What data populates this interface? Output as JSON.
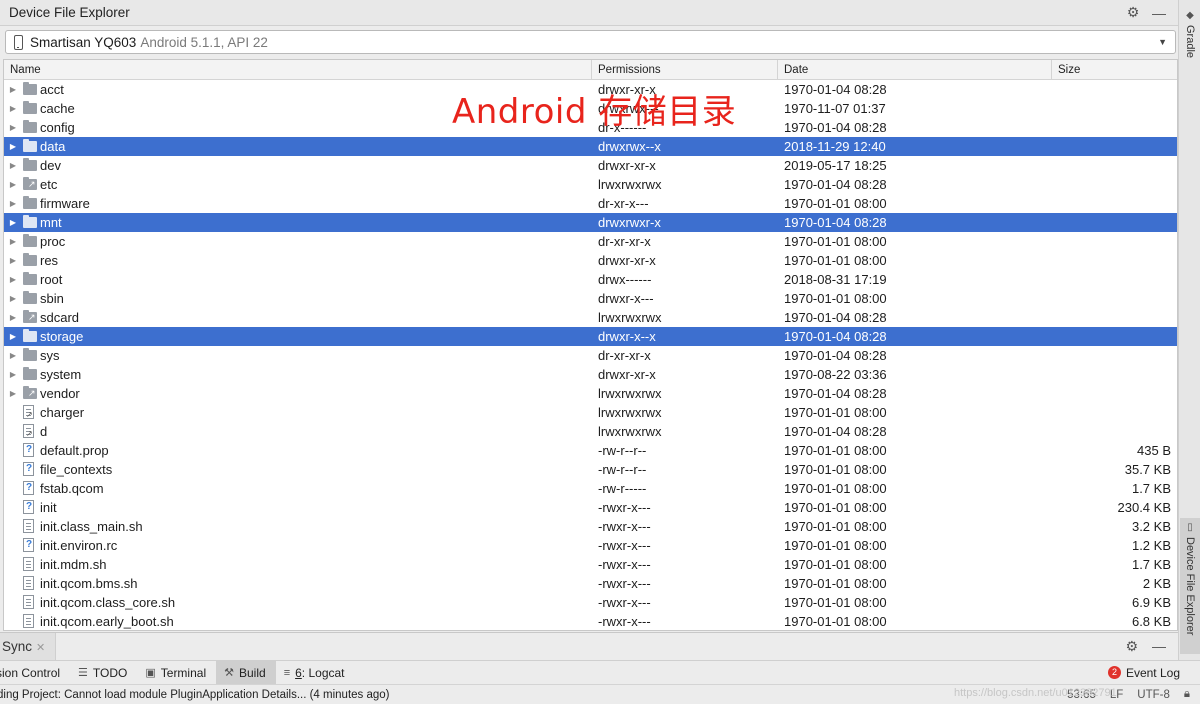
{
  "window": {
    "title": "Device File Explorer",
    "actions": [
      "gear-icon",
      "minimize-icon"
    ]
  },
  "device": {
    "name": "Smartisan YQ603",
    "os": "Android 5.1.1, API 22"
  },
  "table": {
    "columns": [
      "Name",
      "Permissions",
      "Date",
      "Size"
    ],
    "rows": [
      {
        "name": "acct",
        "perm": "drwxr-xr-x",
        "date": "1970-01-04 08:28",
        "size": "",
        "kind": "folder",
        "selected": false
      },
      {
        "name": "cache",
        "perm": "drwxrwx---",
        "date": "1970-11-07 01:37",
        "size": "",
        "kind": "folder",
        "selected": false
      },
      {
        "name": "config",
        "perm": "dr-x------",
        "date": "1970-01-04 08:28",
        "size": "",
        "kind": "folder",
        "selected": false
      },
      {
        "name": "data",
        "perm": "drwxrwx--x",
        "date": "2018-11-29 12:40",
        "size": "",
        "kind": "folder",
        "selected": true
      },
      {
        "name": "dev",
        "perm": "drwxr-xr-x",
        "date": "2019-05-17 18:25",
        "size": "",
        "kind": "folder",
        "selected": false
      },
      {
        "name": "etc",
        "perm": "lrwxrwxrwx",
        "date": "1970-01-04 08:28",
        "size": "",
        "kind": "link-folder",
        "selected": false
      },
      {
        "name": "firmware",
        "perm": "dr-xr-x---",
        "date": "1970-01-01 08:00",
        "size": "",
        "kind": "folder",
        "selected": false
      },
      {
        "name": "mnt",
        "perm": "drwxrwxr-x",
        "date": "1970-01-04 08:28",
        "size": "",
        "kind": "folder",
        "selected": true
      },
      {
        "name": "proc",
        "perm": "dr-xr-xr-x",
        "date": "1970-01-01 08:00",
        "size": "",
        "kind": "folder",
        "selected": false
      },
      {
        "name": "res",
        "perm": "drwxr-xr-x",
        "date": "1970-01-01 08:00",
        "size": "",
        "kind": "folder",
        "selected": false
      },
      {
        "name": "root",
        "perm": "drwx------",
        "date": "2018-08-31 17:19",
        "size": "",
        "kind": "folder",
        "selected": false
      },
      {
        "name": "sbin",
        "perm": "drwxr-x---",
        "date": "1970-01-01 08:00",
        "size": "",
        "kind": "folder",
        "selected": false
      },
      {
        "name": "sdcard",
        "perm": "lrwxrwxrwx",
        "date": "1970-01-04 08:28",
        "size": "",
        "kind": "link-folder",
        "selected": false
      },
      {
        "name": "storage",
        "perm": "drwxr-x--x",
        "date": "1970-01-04 08:28",
        "size": "",
        "kind": "folder",
        "selected": true
      },
      {
        "name": "sys",
        "perm": "dr-xr-xr-x",
        "date": "1970-01-04 08:28",
        "size": "",
        "kind": "folder",
        "selected": false
      },
      {
        "name": "system",
        "perm": "drwxr-xr-x",
        "date": "1970-08-22 03:36",
        "size": "",
        "kind": "folder",
        "selected": false
      },
      {
        "name": "vendor",
        "perm": "lrwxrwxrwx",
        "date": "1970-01-04 08:28",
        "size": "",
        "kind": "link-folder",
        "selected": false
      },
      {
        "name": "charger",
        "perm": "lrwxrwxrwx",
        "date": "1970-01-01 08:00",
        "size": "",
        "kind": "link-file",
        "selected": false
      },
      {
        "name": "d",
        "perm": "lrwxrwxrwx",
        "date": "1970-01-04 08:28",
        "size": "",
        "kind": "link-file",
        "selected": false
      },
      {
        "name": "default.prop",
        "perm": "-rw-r--r--",
        "date": "1970-01-01 08:00",
        "size": "435 B",
        "kind": "unknown-file",
        "selected": false
      },
      {
        "name": "file_contexts",
        "perm": "-rw-r--r--",
        "date": "1970-01-01 08:00",
        "size": "35.7 KB",
        "kind": "unknown-file",
        "selected": false
      },
      {
        "name": "fstab.qcom",
        "perm": "-rw-r-----",
        "date": "1970-01-01 08:00",
        "size": "1.7 KB",
        "kind": "unknown-file",
        "selected": false
      },
      {
        "name": "init",
        "perm": "-rwxr-x---",
        "date": "1970-01-01 08:00",
        "size": "230.4 KB",
        "kind": "unknown-file",
        "selected": false
      },
      {
        "name": "init.class_main.sh",
        "perm": "-rwxr-x---",
        "date": "1970-01-01 08:00",
        "size": "3.2 KB",
        "kind": "text-file",
        "selected": false
      },
      {
        "name": "init.environ.rc",
        "perm": "-rwxr-x---",
        "date": "1970-01-01 08:00",
        "size": "1.2 KB",
        "kind": "unknown-file",
        "selected": false
      },
      {
        "name": "init.mdm.sh",
        "perm": "-rwxr-x---",
        "date": "1970-01-01 08:00",
        "size": "1.7 KB",
        "kind": "text-file",
        "selected": false
      },
      {
        "name": "init.qcom.bms.sh",
        "perm": "-rwxr-x---",
        "date": "1970-01-01 08:00",
        "size": "2 KB",
        "kind": "text-file",
        "selected": false
      },
      {
        "name": "init.qcom.class_core.sh",
        "perm": "-rwxr-x---",
        "date": "1970-01-01 08:00",
        "size": "6.9 KB",
        "kind": "text-file",
        "selected": false
      },
      {
        "name": "init.qcom.early_boot.sh",
        "perm": "-rwxr-x---",
        "date": "1970-01-01 08:00",
        "size": "6.8 KB",
        "kind": "text-file",
        "selected": false
      }
    ]
  },
  "annotation": "Android 存储目录",
  "right_sidebar": {
    "gradle": "Gradle",
    "device_file_explorer": "Device File Explorer"
  },
  "sync_panel": {
    "tab": "Sync"
  },
  "tool_tabs": {
    "version_control": "sion Control",
    "todo": "TODO",
    "terminal": "Terminal",
    "build": "Build",
    "logcat_num": "6",
    "logcat": ": Logcat",
    "event_log_count": "2",
    "event_log": "Event Log"
  },
  "status": {
    "message": "ding Project: Cannot load module PluginApplication Details... (4 minutes ago)",
    "position": "53:65",
    "line_sep": "LF",
    "encoding": "UTF-8",
    "watermark": "https://blog.csdn.net/u012382791"
  },
  "colors": {
    "selection": "#3d6fcf",
    "annotation": "#e8241c"
  }
}
